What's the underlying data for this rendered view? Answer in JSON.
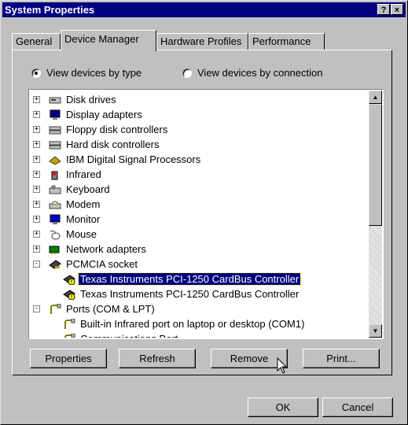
{
  "window": {
    "title": "System Properties",
    "help_label": "?",
    "close_label": "×"
  },
  "tabs": [
    "General",
    "Device Manager",
    "Hardware Profiles",
    "Performance"
  ],
  "radios": {
    "by_type": "View devices by type",
    "by_connection": "View devices by connection",
    "selected": "by_type"
  },
  "tree": [
    {
      "label": "Disk drives",
      "icon": "disk-icon",
      "expander": "+"
    },
    {
      "label": "Display adapters",
      "icon": "display-icon",
      "expander": "+"
    },
    {
      "label": "Floppy disk controllers",
      "icon": "controller-icon",
      "expander": "+"
    },
    {
      "label": "Hard disk controllers",
      "icon": "controller-icon",
      "expander": "+"
    },
    {
      "label": "IBM Digital Signal Processors",
      "icon": "dsp-icon",
      "expander": "+"
    },
    {
      "label": "Infrared",
      "icon": "infrared-icon",
      "expander": "+"
    },
    {
      "label": "Keyboard",
      "icon": "keyboard-icon",
      "expander": "+"
    },
    {
      "label": "Modem",
      "icon": "modem-icon",
      "expander": "+"
    },
    {
      "label": "Monitor",
      "icon": "monitor-icon",
      "expander": "+"
    },
    {
      "label": "Mouse",
      "icon": "mouse-icon",
      "expander": "+"
    },
    {
      "label": "Network adapters",
      "icon": "network-icon",
      "expander": "+"
    },
    {
      "label": "PCMCIA socket",
      "icon": "pcmcia-icon",
      "expander": "-"
    },
    {
      "label": "Texas Instruments PCI-1250 CardBus Controller",
      "icon": "warning-device-icon",
      "child": true,
      "selected": true
    },
    {
      "label": "Texas Instruments PCI-1250 CardBus Controller",
      "icon": "warning-device-icon",
      "child": true
    },
    {
      "label": "Ports (COM & LPT)",
      "icon": "port-icon",
      "expander": "-"
    },
    {
      "label": "Built-in Infrared port on laptop or desktop (COM1)",
      "icon": "port-icon",
      "child": true
    },
    {
      "label": "Communications Port",
      "icon": "port-icon",
      "child": true
    }
  ],
  "buttons": {
    "properties": "Properties",
    "refresh": "Refresh",
    "remove": "Remove",
    "print": "Print...",
    "ok": "OK",
    "cancel": "Cancel"
  }
}
